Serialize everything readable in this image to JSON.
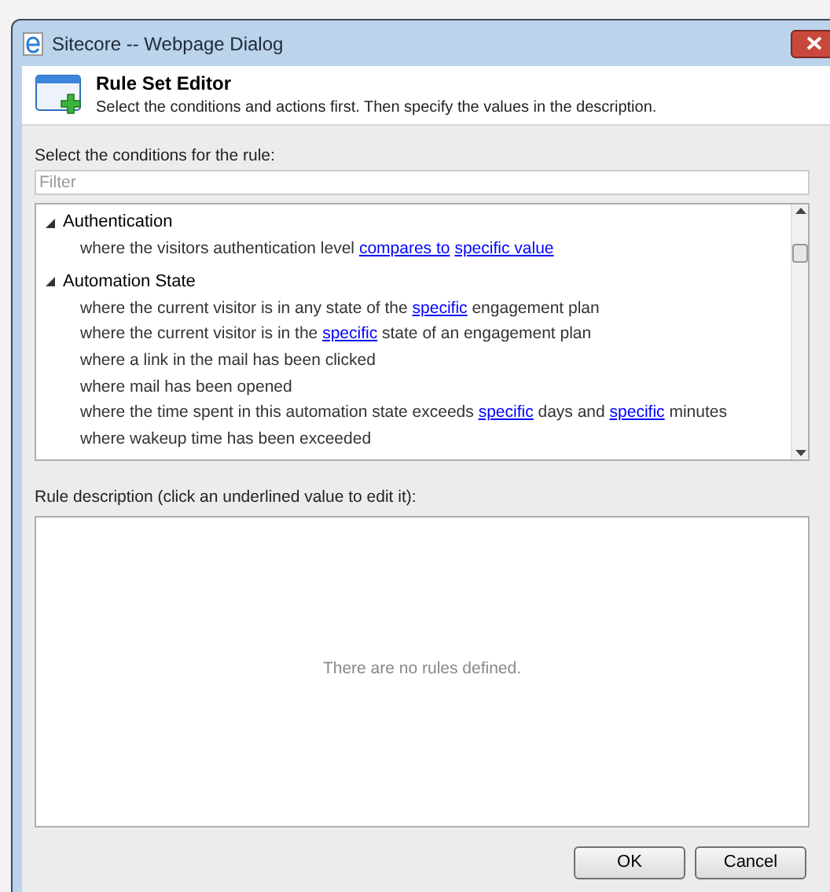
{
  "window": {
    "title": "Sitecore -- Webpage Dialog"
  },
  "header": {
    "title": "Rule Set Editor",
    "subtitle": "Select the conditions and actions first. Then specify the values in the description."
  },
  "conditions": {
    "label": "Select the conditions for the rule:",
    "filter": {
      "placeholder": "Filter"
    },
    "groups": [
      {
        "name": "Authentication",
        "expanded": true,
        "items": [
          [
            {
              "kind": "text",
              "text": "where the visitors authentication level "
            },
            {
              "kind": "link",
              "text": "compares to"
            },
            {
              "kind": "link",
              "text": "specific value"
            }
          ]
        ]
      },
      {
        "name": "Automation State",
        "expanded": true,
        "items": [
          [
            {
              "kind": "text",
              "text": "where the current visitor is in any state of the "
            },
            {
              "kind": "link",
              "text": "specific"
            },
            {
              "kind": "text",
              "text": " engagement plan"
            }
          ],
          [
            {
              "kind": "text",
              "text": "where the current visitor is in the "
            },
            {
              "kind": "link",
              "text": "specific"
            },
            {
              "kind": "text",
              "text": " state of an engagement plan"
            }
          ],
          [
            {
              "kind": "text",
              "text": "where a link in the mail has been clicked"
            }
          ],
          [
            {
              "kind": "text",
              "text": "where mail has been opened"
            }
          ],
          [
            {
              "kind": "text",
              "text": "where the time spent in this automation state exceeds "
            },
            {
              "kind": "link",
              "text": "specific"
            },
            {
              "kind": "text",
              "text": " days and "
            },
            {
              "kind": "link",
              "text": "specific"
            },
            {
              "kind": "text",
              "text": " minutes"
            }
          ],
          [
            {
              "kind": "text",
              "text": "where wakeup time has been exceeded"
            }
          ]
        ]
      }
    ]
  },
  "description": {
    "label": "Rule description (click an underlined value to edit it):",
    "empty_text": "There are no rules defined."
  },
  "buttons": [
    "OK",
    "Cancel"
  ]
}
